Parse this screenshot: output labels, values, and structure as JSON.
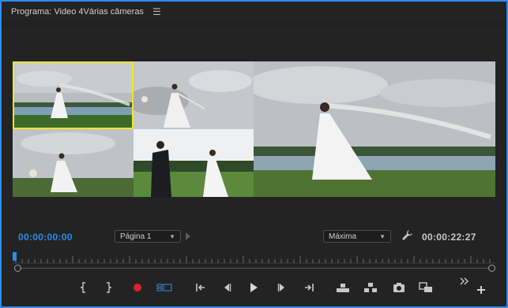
{
  "panel": {
    "title": "Programa: Video 4Várias câmeras",
    "menu_icon": "hamburger-icon"
  },
  "viewer": {
    "cameras": [
      {
        "id": 1,
        "selected": true,
        "scene": "bride-veil-lake"
      },
      {
        "id": 2,
        "selected": false,
        "scene": "bride-bouquet-sky"
      },
      {
        "id": 3,
        "selected": false,
        "scene": "bride-bouquet-tree"
      },
      {
        "id": 4,
        "selected": false,
        "scene": "couple-walking"
      }
    ],
    "program": {
      "scene": "bride-veil-wide"
    },
    "selected_color": "#f0e52c"
  },
  "controls": {
    "current_timecode": "00:00:00:00",
    "duration_timecode": "00:00:22:27",
    "page_select": "Página 1",
    "quality_select": "Máxima"
  },
  "transport": {
    "buttons": [
      "mark-in",
      "mark-out",
      "record",
      "multicam-view",
      "go-to-in",
      "step-back",
      "play",
      "step-forward",
      "go-to-out",
      "lift",
      "extract",
      "export-frame",
      "overwrite",
      "more",
      "add"
    ]
  },
  "colors": {
    "accent": "#2d8ceb",
    "record": "#e0202a",
    "background": "#232323"
  }
}
